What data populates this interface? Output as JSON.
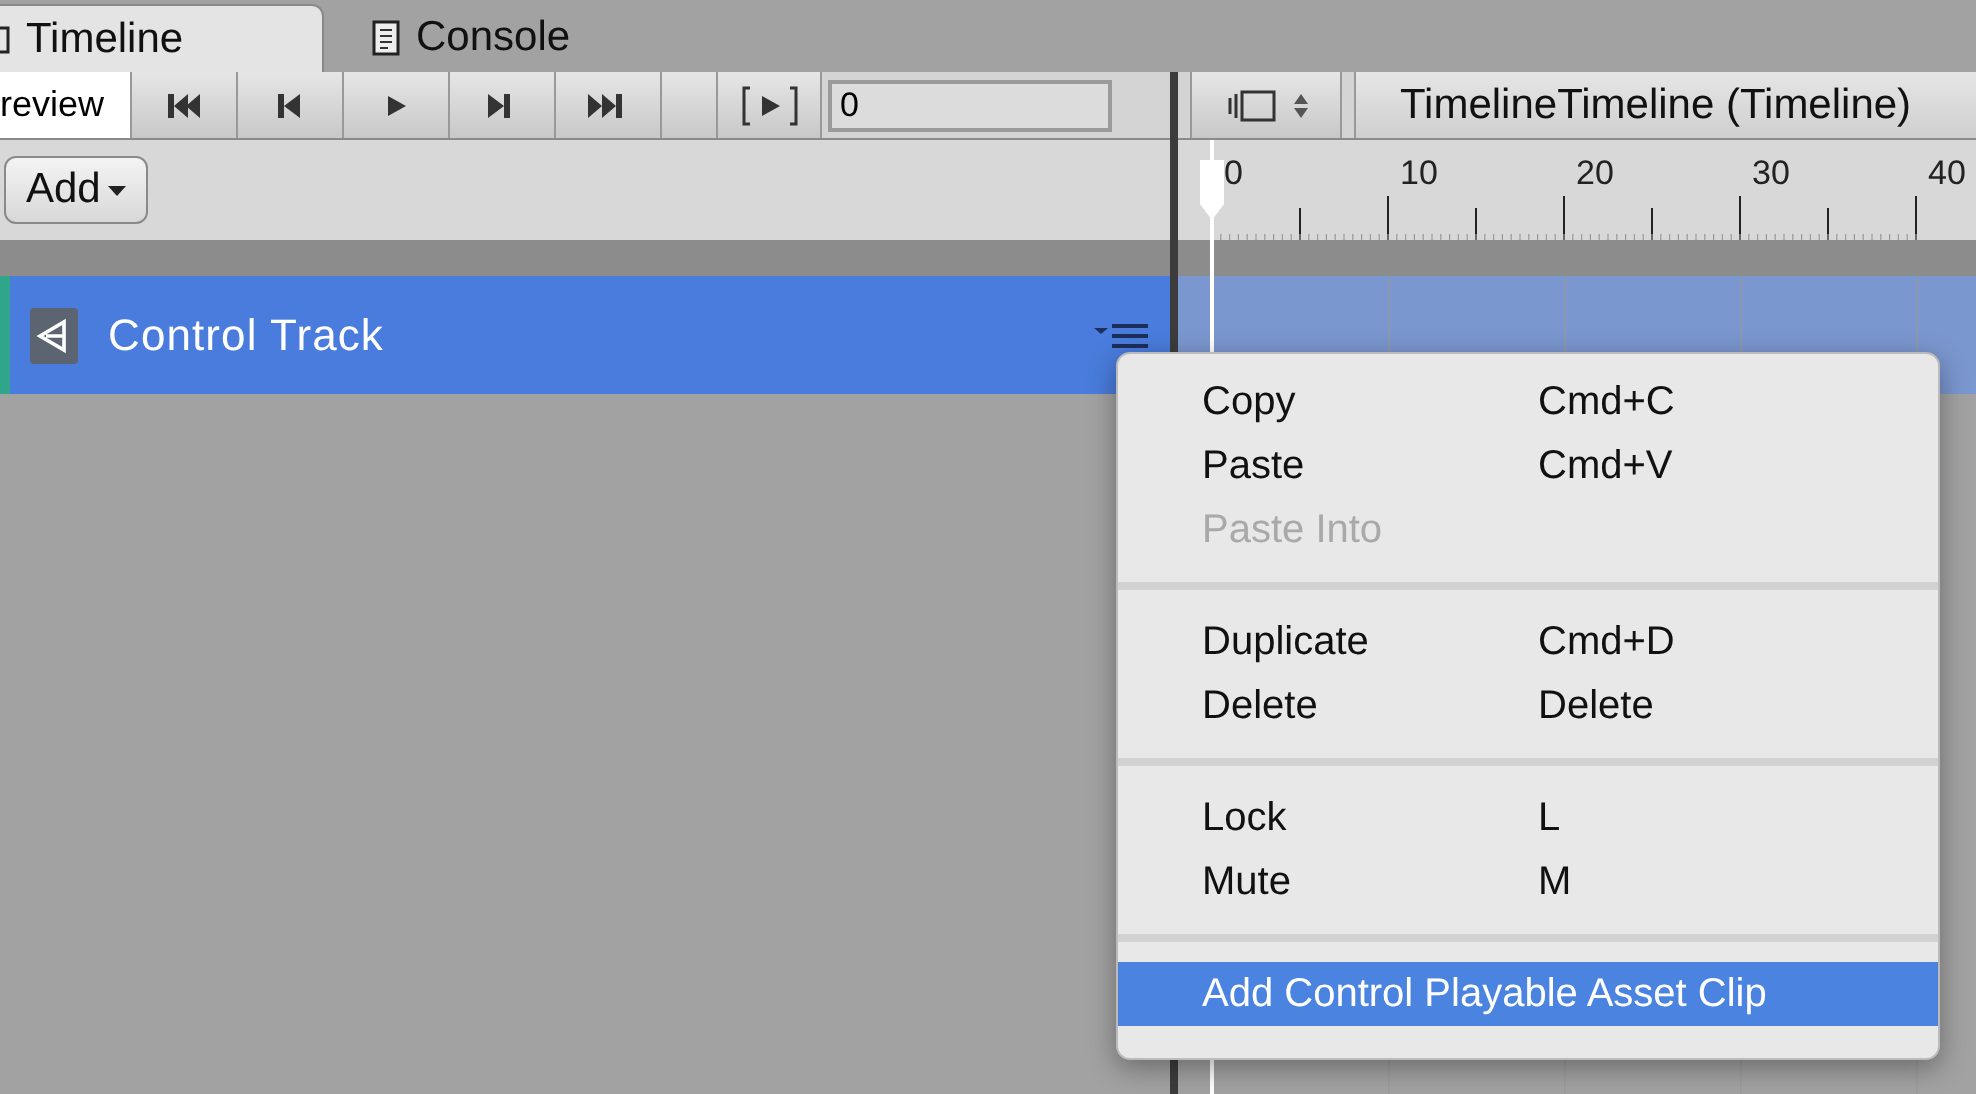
{
  "tabs": [
    {
      "label": "Timeline",
      "selected": true
    },
    {
      "label": "Console",
      "selected": false
    }
  ],
  "toolbar": {
    "preview_label": "review",
    "preview_on": true,
    "frame_field": "0",
    "add_button": "Add"
  },
  "timeline_asset": "TimelineTimeline (Timeline)",
  "ruler": {
    "labels": [
      "0",
      "10",
      "20",
      "30",
      "40"
    ]
  },
  "tracks": [
    {
      "name": "Control Track",
      "selected": true
    }
  ],
  "context_menu": {
    "groups": [
      [
        {
          "label": "Copy",
          "shortcut": "Cmd+C",
          "disabled": false,
          "selected": false
        },
        {
          "label": "Paste",
          "shortcut": "Cmd+V",
          "disabled": false,
          "selected": false
        },
        {
          "label": "Paste Into",
          "disabled": true,
          "selected": false
        }
      ],
      [
        {
          "label": "Duplicate",
          "shortcut": "Cmd+D",
          "disabled": false,
          "selected": false
        },
        {
          "label": "Delete",
          "shortcut": "Delete",
          "disabled": false,
          "selected": false
        }
      ],
      [
        {
          "label": "Lock",
          "shortcut": "L",
          "disabled": false,
          "selected": false
        },
        {
          "label": "Mute",
          "shortcut": "M",
          "disabled": false,
          "selected": false
        }
      ],
      [
        {
          "label": "Add Control Playable Asset Clip",
          "disabled": false,
          "selected": true
        }
      ]
    ]
  }
}
